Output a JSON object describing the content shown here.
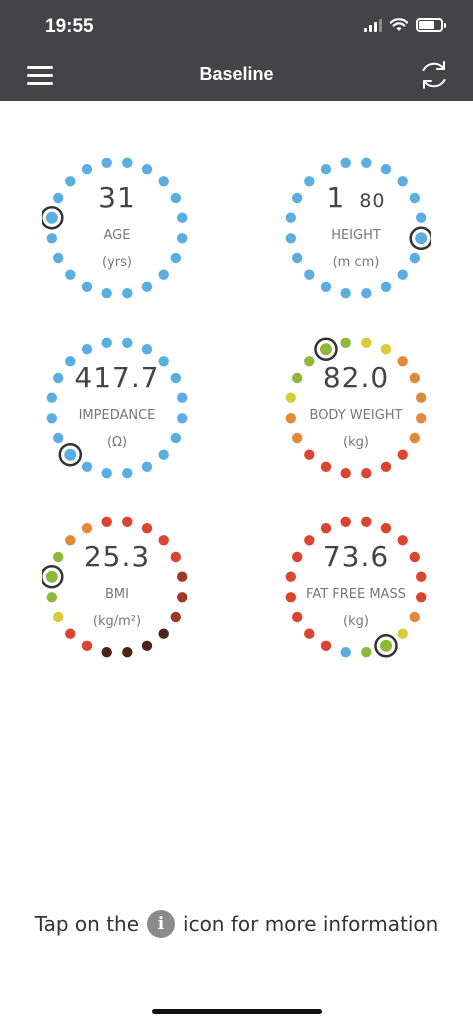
{
  "status_bar": {
    "time": "19:55"
  },
  "header": {
    "title": "Baseline"
  },
  "dials": {
    "age": {
      "value": "31",
      "label": "AGE",
      "unit": "(yrs)",
      "dots": [
        "b",
        "b",
        "b",
        "b",
        "b",
        "b",
        "b",
        "b",
        "b",
        "b",
        "b",
        "b",
        "b",
        "b",
        "b",
        "b",
        "b",
        "b",
        "b",
        "b"
      ],
      "marker": 15
    },
    "height": {
      "value_main": "1",
      "value_small": "80",
      "label": "HEIGHT",
      "unit": "(m cm)",
      "dots": [
        "b",
        "b",
        "b",
        "b",
        "b",
        "b",
        "b",
        "b",
        "b",
        "b",
        "b",
        "b",
        "b",
        "b",
        "b",
        "b",
        "b",
        "b",
        "b",
        "b"
      ],
      "marker": 5
    },
    "impedance": {
      "value": "417.7",
      "label": "IMPEDANCE",
      "unit": "(Ω)",
      "dots": [
        "b",
        "b",
        "b",
        "b",
        "b",
        "b",
        "b",
        "b",
        "b",
        "b",
        "b",
        "b",
        "b",
        "b",
        "b",
        "b",
        "b",
        "b",
        "b",
        "b"
      ],
      "marker": 12
    },
    "body_weight": {
      "value": "82.0",
      "label": "BODY WEIGHT",
      "unit": "(kg)",
      "dots": [
        "y",
        "y",
        "o",
        "o",
        "o",
        "o",
        "o",
        "r",
        "r",
        "r",
        "r",
        "r",
        "r",
        "o",
        "o",
        "y",
        "g",
        "g",
        "g",
        "g"
      ],
      "marker": 18
    },
    "bmi": {
      "value": "25.3",
      "label": "BMI",
      "unit": "(kg/m²)",
      "dots": [
        "r",
        "r",
        "r",
        "r",
        "br",
        "br",
        "br",
        "dk",
        "dk",
        "dk",
        "dk",
        "r",
        "r",
        "y",
        "g",
        "g",
        "g",
        "o",
        "o",
        "r"
      ],
      "marker": 15
    },
    "fat_free_mass": {
      "value": "73.6",
      "label": "FAT FREE MASS",
      "unit": "(kg)",
      "dots": [
        "r",
        "r",
        "r",
        "r",
        "r",
        "r",
        "o",
        "y",
        "g",
        "g",
        "bl",
        "r",
        "r",
        "r",
        "r",
        "r",
        "r",
        "r",
        "r",
        "r"
      ],
      "marker": 8
    }
  },
  "dot_colors": {
    "b": "#5aaee0",
    "bl": "#5aaee0",
    "y": "#d8cc3a",
    "g": "#8db83a",
    "o": "#e08a3a",
    "r": "#d9452e",
    "br": "#9c3a28",
    "dk": "#4a2418"
  },
  "footer": {
    "info_prefix": "Tap on the",
    "info_suffix": "icon for more information",
    "info_icon": "i"
  }
}
